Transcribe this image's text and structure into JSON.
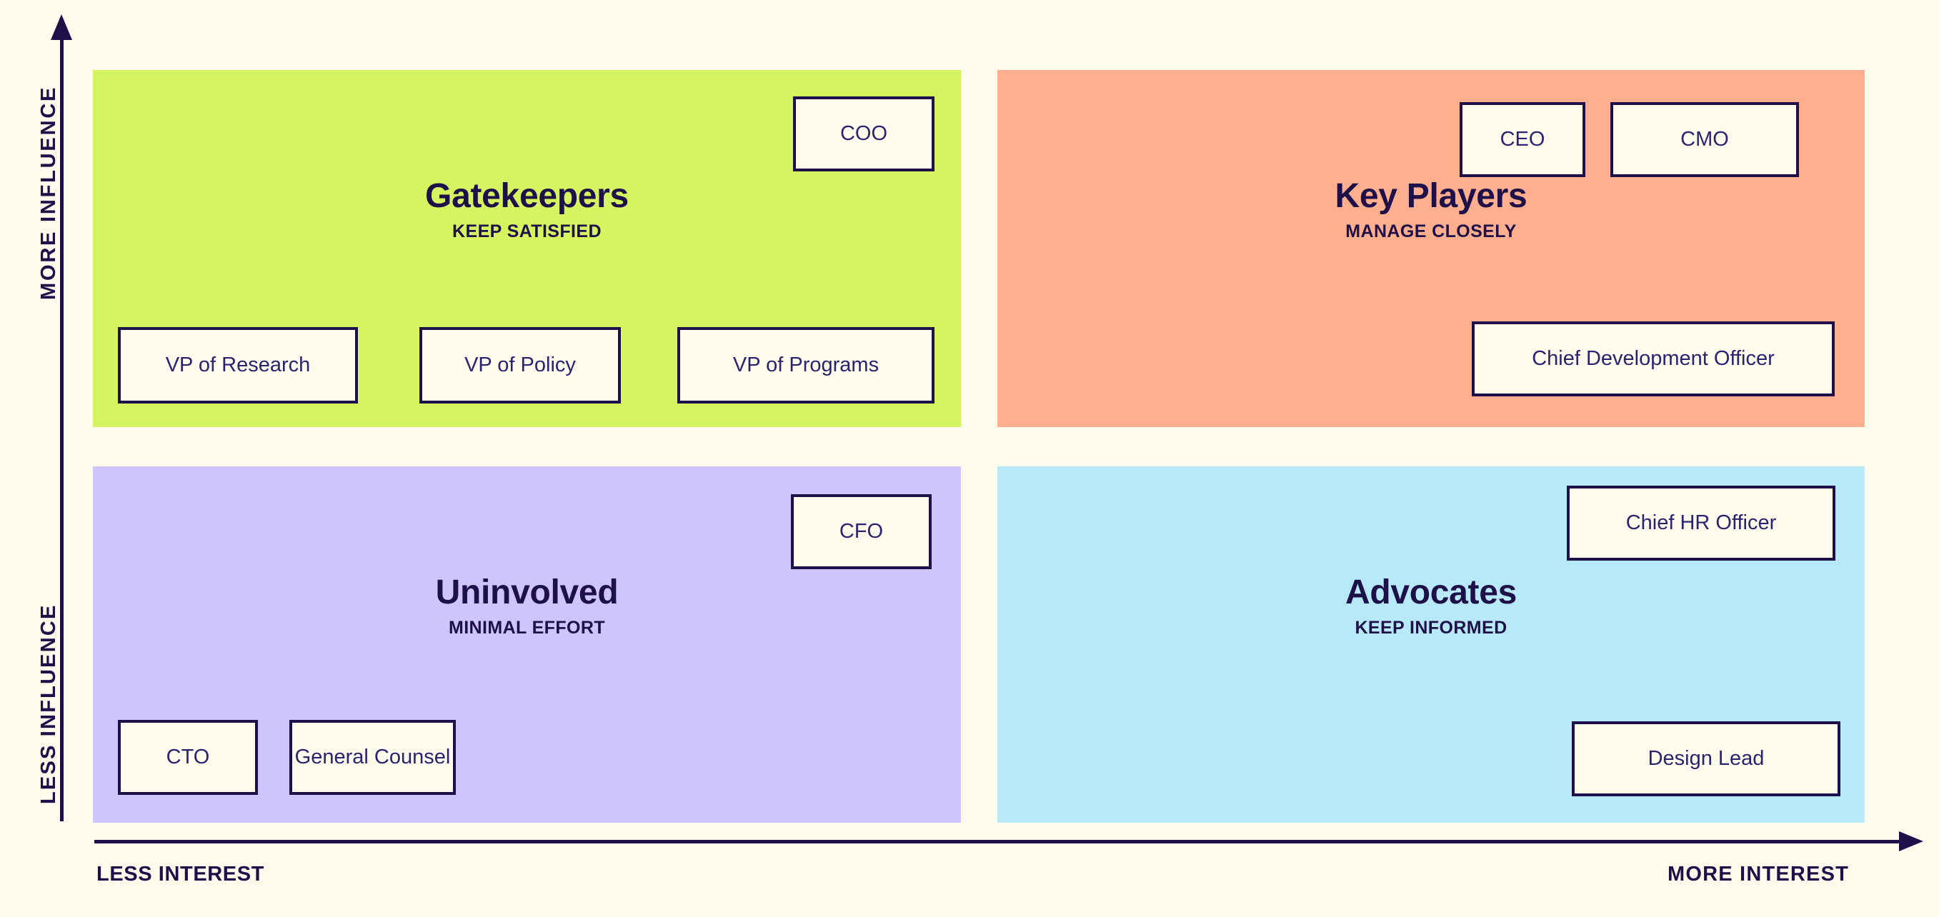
{
  "colors": {
    "background": "#FDFBEC",
    "ink": "#1E1049",
    "card_text": "#2E2170",
    "card_fill": "#FDFBEC",
    "gatekeepers_fill": "#D6F45F",
    "key_players_fill": "#FFAE8E",
    "uninvolved_fill": "#CFC4FB",
    "advocates_fill": "#B8E9F8"
  },
  "axes": {
    "y_top_label": "MORE  INFLUENCE",
    "y_bottom_label": "LESS INFLUENCE",
    "x_left_label": "LESS INTEREST",
    "x_right_label": "MORE  INTEREST",
    "y_arrow_icon": "arrow-up-icon",
    "x_arrow_icon": "arrow-right-icon"
  },
  "quadrants": [
    {
      "id": "gatekeepers",
      "title": "Gatekeepers",
      "subtitle": "KEEP SATISFIED",
      "fill": "#D6F45F",
      "stakeholders": [
        "COO",
        "VP of Research",
        "VP of Policy",
        "VP of Programs"
      ]
    },
    {
      "id": "key-players",
      "title": "Key Players",
      "subtitle": "MANAGE CLOSELY",
      "fill": "#FFAE8E",
      "stakeholders": [
        "CEO",
        "CMO",
        "Chief Development Officer"
      ]
    },
    {
      "id": "uninvolved",
      "title": "Uninvolved",
      "subtitle": "MINIMAL EFFORT",
      "fill": "#CFC4FB",
      "stakeholders": [
        "CFO",
        "CTO",
        "General Counsel"
      ]
    },
    {
      "id": "advocates",
      "title": "Advocates",
      "subtitle": "KEEP INFORMED",
      "fill": "#B8E9F8",
      "stakeholders": [
        "Chief HR Officer",
        "Design Lead"
      ]
    }
  ],
  "cards": {
    "coo": "COO",
    "vp_research": "VP of Research",
    "vp_policy": "VP of Policy",
    "vp_programs": "VP of Programs",
    "ceo": "CEO",
    "cmo": "CMO",
    "chief_development_officer": "Chief Development Officer",
    "cfo": "CFO",
    "cto": "CTO",
    "general_counsel": "General Counsel",
    "chief_hr_officer": "Chief HR Officer",
    "design_lead": "Design Lead"
  }
}
